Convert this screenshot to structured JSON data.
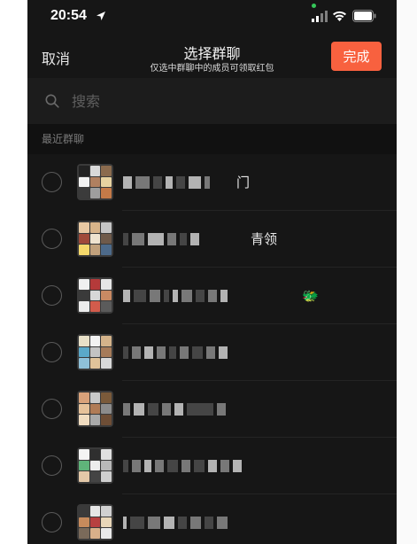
{
  "status_bar": {
    "time": "20:54",
    "location_icon": "location-arrow-icon",
    "signal_icon": "cellular-signal-icon",
    "wifi_icon": "wifi-icon",
    "battery_icon": "battery-icon"
  },
  "nav": {
    "cancel_label": "取消",
    "title": "选择群聊",
    "subtitle": "仅选中群聊中的成员可领取红包",
    "done_label": "完成",
    "done_color": "#f8613f"
  },
  "search": {
    "placeholder": "搜索",
    "value": ""
  },
  "section": {
    "recent_label": "最近群聊"
  },
  "groups": [
    {
      "name_tail": "门",
      "name_blurred": "▆▆ ▆▆ ▆ ▆▆"
    },
    {
      "name_tail": "青领",
      "name_blurred": "▆▆▆▆▆ ▆▆"
    },
    {
      "name_tail": "🐲",
      "name_blurred": "乞 ▆ 亡 代 ▆ ▆ ▆ ▆ ▆"
    },
    {
      "name_tail": "",
      "name_blurred": "▆ ▆ ▆ ▆ ▆ ▆ ▆ ▆"
    },
    {
      "name_tail": "",
      "name_blurred": "▆ ▆ ▆ ▆"
    },
    {
      "name_tail": "",
      "name_blurred": "▆ ▆ ▆ ▆ ▆ ▆ ▆ ▆ ▆ ▆"
    },
    {
      "name_tail": "",
      "name_blurred": "[ ▆ ▆ ▆ ▆ ▆ ▆ ▆"
    }
  ],
  "colors": {
    "background": "#161616",
    "accent": "#f8613f",
    "text": "#e6e6e6"
  }
}
